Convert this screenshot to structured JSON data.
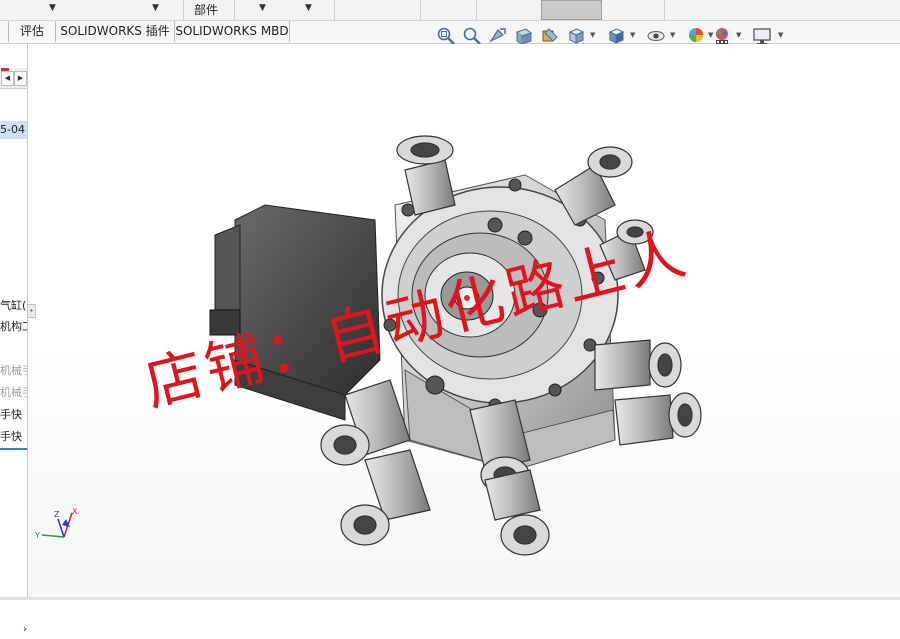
{
  "top_bar": {
    "label": "部件"
  },
  "tabs": [
    {
      "label": "评估"
    },
    {
      "label": "SOLIDWORKS 插件"
    },
    {
      "label": "SOLIDWORKS MBD"
    }
  ],
  "feature_tree": {
    "items": [
      {
        "label": "5-04",
        "state": "selected"
      },
      {
        "label": "气缸(",
        "state": "normal"
      },
      {
        "label": "机构工",
        "state": "normal"
      },
      {
        "label": "机械手",
        "state": "suppressed"
      },
      {
        "label": "机械手",
        "state": "suppressed"
      },
      {
        "label": "手快",
        "state": "normal"
      },
      {
        "label": "手快",
        "state": "active"
      }
    ]
  },
  "heads_up_toolbar": {
    "icons": [
      "zoom-to-fit-icon",
      "zoom-to-area-icon",
      "previous-view-icon",
      "section-view-icon",
      "dynamic-annotation-icon",
      "view-orientation-icon",
      "display-style-icon",
      "hide-show-items-icon",
      "edit-appearance-icon",
      "apply-scene-icon",
      "view-settings-icon"
    ]
  },
  "triad": {
    "x_label": "X",
    "y_label": "Y",
    "z_label": "Z"
  },
  "watermark": {
    "text": "店铺：自动化路上人",
    "color": "#e0141e"
  }
}
